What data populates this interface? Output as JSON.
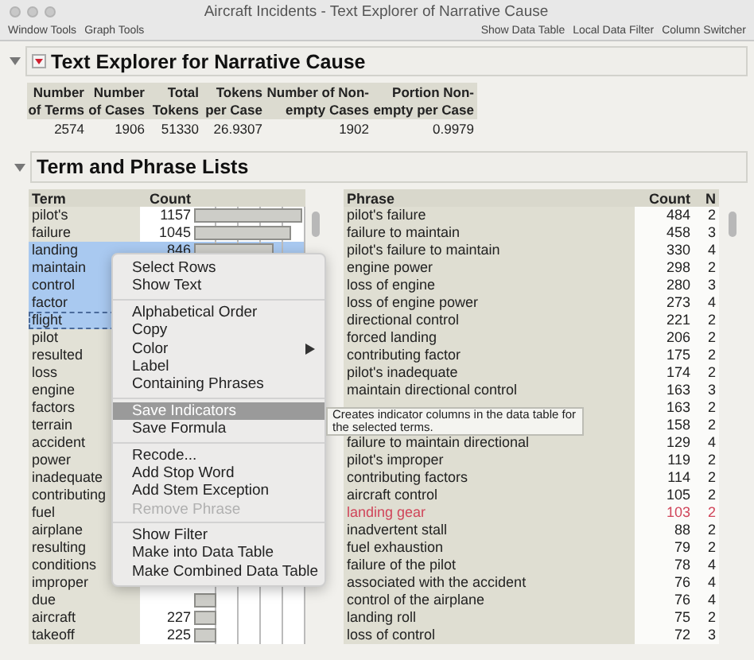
{
  "window": {
    "title": "Aircraft Incidents - Text Explorer of Narrative Cause"
  },
  "toolbar": {
    "left": [
      "Window Tools",
      "Graph Tools"
    ],
    "right": [
      "Show Data Table",
      "Local Data Filter",
      "Column Switcher"
    ]
  },
  "report": {
    "title": "Text Explorer for Narrative Cause",
    "expanded": true,
    "summary": {
      "columns": [
        "Number of Terms",
        "Number of Cases",
        "Total Tokens",
        "Tokens per Case",
        "Number of Non-empty Cases",
        "Portion Non-empty per Case"
      ],
      "values": [
        "2574",
        "1906",
        "51330",
        "26.9307",
        "1902",
        "0.9979"
      ]
    }
  },
  "lists": {
    "title": "Term and Phrase Lists",
    "expanded": true,
    "terms": {
      "columns": [
        "Term",
        "Count"
      ],
      "rows": [
        {
          "term": "pilot's",
          "count": "1157",
          "level": 1,
          "selected": false,
          "focused": false
        },
        {
          "term": "failure",
          "count": "1045",
          "level": 0.9,
          "selected": false,
          "focused": false
        },
        {
          "term": "landing",
          "count": "846",
          "level": 0.73,
          "selected": true,
          "focused": false
        },
        {
          "term": "maintain",
          "selected": true,
          "focused": false
        },
        {
          "term": "control",
          "selected": true,
          "focused": false
        },
        {
          "term": "factor",
          "selected": true,
          "focused": false
        },
        {
          "term": "flight",
          "selected": true,
          "focused": true
        },
        {
          "term": "pilot",
          "selected": false,
          "focused": false
        },
        {
          "term": "resulted",
          "selected": false,
          "focused": false
        },
        {
          "term": "loss",
          "selected": false,
          "focused": false
        },
        {
          "term": "engine",
          "selected": false,
          "focused": false
        },
        {
          "term": "factors",
          "selected": false,
          "focused": false
        },
        {
          "term": "terrain",
          "selected": false,
          "focused": false
        },
        {
          "term": "accident",
          "selected": false,
          "focused": false
        },
        {
          "term": "power",
          "selected": false,
          "focused": false
        },
        {
          "term": "inadequate",
          "selected": false,
          "focused": false
        },
        {
          "term": "contributing",
          "selected": false,
          "focused": false
        },
        {
          "term": "fuel",
          "selected": false,
          "focused": false
        },
        {
          "term": "airplane",
          "selected": false,
          "focused": false
        },
        {
          "term": "resulting",
          "selected": false,
          "focused": false
        },
        {
          "term": "conditions",
          "selected": false,
          "focused": false
        },
        {
          "term": "improper",
          "selected": false,
          "focused": false
        },
        {
          "term": "due",
          "level": 0.2,
          "selected": false,
          "focused": false
        },
        {
          "term": "aircraft",
          "count": "227",
          "level": 0.2,
          "selected": false,
          "focused": false
        },
        {
          "term": "takeoff",
          "count": "225",
          "level": 0.2,
          "selected": false,
          "focused": false
        }
      ]
    },
    "phrases": {
      "columns": [
        "Phrase",
        "Count",
        "N"
      ],
      "rows": [
        {
          "phrase": "pilot's failure",
          "count": "484",
          "n": "2"
        },
        {
          "phrase": "failure to maintain",
          "count": "458",
          "n": "3"
        },
        {
          "phrase": "pilot's failure to maintain",
          "count": "330",
          "n": "4"
        },
        {
          "phrase": "engine power",
          "count": "298",
          "n": "2"
        },
        {
          "phrase": "loss of engine",
          "count": "280",
          "n": "3"
        },
        {
          "phrase": "loss of engine power",
          "count": "273",
          "n": "4"
        },
        {
          "phrase": "directional control",
          "count": "221",
          "n": "2"
        },
        {
          "phrase": "forced landing",
          "count": "206",
          "n": "2"
        },
        {
          "phrase": "contributing factor",
          "count": "175",
          "n": "2"
        },
        {
          "phrase": "pilot's inadequate",
          "count": "174",
          "n": "2"
        },
        {
          "phrase": "maintain directional control",
          "count": "163",
          "n": "3"
        },
        {
          "count": "163",
          "n": "2"
        },
        {
          "count": "158",
          "n": "2"
        },
        {
          "phrase": "failure to maintain directional",
          "count": "129",
          "n": "4"
        },
        {
          "phrase": "pilot's improper",
          "count": "119",
          "n": "2"
        },
        {
          "phrase": "contributing factors",
          "count": "114",
          "n": "2"
        },
        {
          "phrase": "aircraft control",
          "count": "105",
          "n": "2"
        },
        {
          "phrase": "landing gear",
          "count": "103",
          "n": "2",
          "color": "#d0455a"
        },
        {
          "phrase": "inadvertent stall",
          "count": "88",
          "n": "2"
        },
        {
          "phrase": "fuel exhaustion",
          "count": "79",
          "n": "2"
        },
        {
          "phrase": "failure of the pilot",
          "count": "78",
          "n": "4"
        },
        {
          "phrase": "associated with the accident",
          "count": "76",
          "n": "4"
        },
        {
          "phrase": "control of the airplane",
          "count": "76",
          "n": "4"
        },
        {
          "phrase": "landing roll",
          "count": "75",
          "n": "2"
        },
        {
          "phrase": "loss of control",
          "count": "72",
          "n": "3"
        }
      ]
    }
  },
  "context_menu": {
    "groups": [
      [
        {
          "label": "Select Rows",
          "selected": false,
          "disabled": false,
          "submenu": false
        },
        {
          "label": "Show Text",
          "selected": false,
          "disabled": false,
          "submenu": false
        }
      ],
      [
        {
          "label": "Alphabetical Order",
          "selected": false,
          "disabled": false,
          "submenu": false
        },
        {
          "label": "Copy",
          "selected": false,
          "disabled": false,
          "submenu": false
        },
        {
          "label": "Color",
          "selected": false,
          "disabled": false,
          "submenu": true
        },
        {
          "label": "Label",
          "selected": false,
          "disabled": false,
          "submenu": false
        },
        {
          "label": "Containing Phrases",
          "selected": false,
          "disabled": false,
          "submenu": false
        }
      ],
      [
        {
          "label": "Save Indicators",
          "selected": true,
          "disabled": false,
          "submenu": false
        },
        {
          "label": "Save Formula",
          "selected": false,
          "disabled": false,
          "submenu": false
        }
      ],
      [
        {
          "label": "Recode...",
          "selected": false,
          "disabled": false,
          "submenu": false
        },
        {
          "label": "Add Stop Word",
          "selected": false,
          "disabled": false,
          "submenu": false
        },
        {
          "label": "Add Stem Exception",
          "selected": false,
          "disabled": false,
          "submenu": false
        },
        {
          "label": "Remove Phrase",
          "selected": false,
          "disabled": true,
          "submenu": false
        }
      ],
      [
        {
          "label": "Show Filter",
          "selected": false,
          "disabled": false,
          "submenu": false
        },
        {
          "label": "Make into Data Table",
          "selected": false,
          "disabled": false,
          "submenu": false
        },
        {
          "label": "Make Combined Data Table",
          "selected": false,
          "disabled": false,
          "submenu": false
        }
      ]
    ]
  },
  "tooltip": "Creates indicator columns in the data table for the selected terms."
}
